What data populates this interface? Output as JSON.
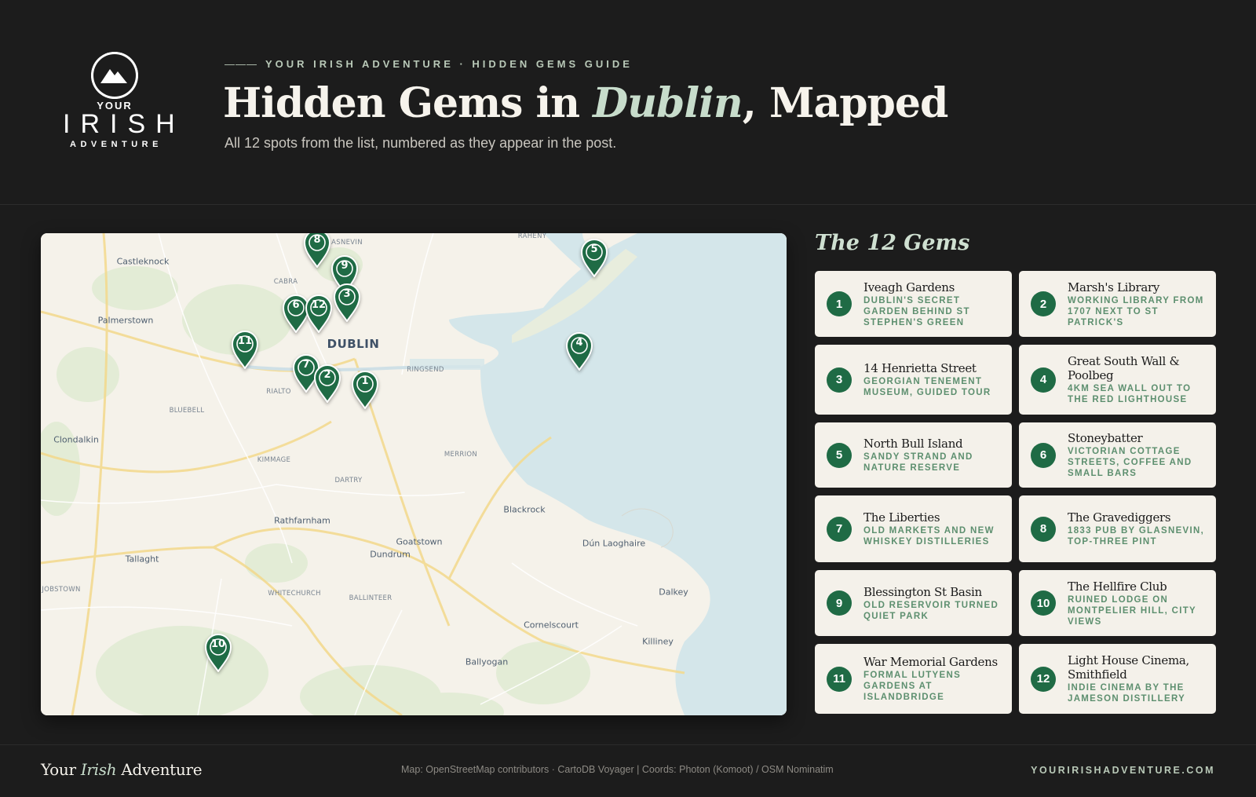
{
  "brand": {
    "logo_your": "YOUR",
    "logo_irish": "IRISH",
    "logo_adventure": "ADVENTURE"
  },
  "header": {
    "kicker_dash": "———",
    "kicker": "YOUR IRISH ADVENTURE · HIDDEN GEMS GUIDE",
    "title_before": "Hidden Gems in ",
    "title_em": "Dublin",
    "title_after": ", Mapped",
    "subtitle": "All 12 spots from the list, numbered as they appear in the post."
  },
  "map": {
    "places": [
      {
        "name": "Castleknock",
        "cls": "major"
      },
      {
        "name": "ASNEVIN",
        "cls": "small"
      },
      {
        "name": "RAHENY",
        "cls": "small"
      },
      {
        "name": "CABRA",
        "cls": "small"
      },
      {
        "name": "Palmerstown",
        "cls": "major"
      },
      {
        "name": "DUBLIN",
        "cls": "city"
      },
      {
        "name": "RINGSEND",
        "cls": "small"
      },
      {
        "name": "RIALTO",
        "cls": "small"
      },
      {
        "name": "BLUEBELL",
        "cls": "small"
      },
      {
        "name": "Clondalkin",
        "cls": "major"
      },
      {
        "name": "MERRION",
        "cls": "small"
      },
      {
        "name": "KIMMAGE",
        "cls": "small"
      },
      {
        "name": "DARTRY",
        "cls": "small"
      },
      {
        "name": "Blackrock",
        "cls": "major"
      },
      {
        "name": "Rathfarnham",
        "cls": "major"
      },
      {
        "name": "Goatstown",
        "cls": "major"
      },
      {
        "name": "Dún Laoghaire",
        "cls": "major"
      },
      {
        "name": "Dundrum",
        "cls": "major"
      },
      {
        "name": "Tallaght",
        "cls": "major"
      },
      {
        "name": "JOBSTOWN",
        "cls": "small"
      },
      {
        "name": "WHITECHURCH",
        "cls": "small"
      },
      {
        "name": "BALLINTEER",
        "cls": "small"
      },
      {
        "name": "Dalkey",
        "cls": "major"
      },
      {
        "name": "Cornelscourt",
        "cls": "major"
      },
      {
        "name": "Killiney",
        "cls": "major"
      },
      {
        "name": "Ballyogan",
        "cls": "major"
      }
    ],
    "pins": [
      "8",
      "9",
      "3",
      "6",
      "12",
      "11",
      "7",
      "2",
      "1",
      "5",
      "4",
      "10"
    ]
  },
  "sidebar": {
    "title": "The 12 Gems",
    "gems": [
      {
        "num": "1",
        "name": "Iveagh Gardens",
        "desc": "Dublin's secret garden behind St Stephen's Green"
      },
      {
        "num": "2",
        "name": "Marsh's Library",
        "desc": "Working library from 1707 next to St Patrick's"
      },
      {
        "num": "3",
        "name": "14 Henrietta Street",
        "desc": "Georgian tenement museum, guided tour"
      },
      {
        "num": "4",
        "name": "Great South Wall & Poolbeg",
        "desc": "4km sea wall out to the red lighthouse"
      },
      {
        "num": "5",
        "name": "North Bull Island",
        "desc": "Sandy strand and nature reserve"
      },
      {
        "num": "6",
        "name": "Stoneybatter",
        "desc": "Victorian cottage streets, coffee and small bars"
      },
      {
        "num": "7",
        "name": "The Liberties",
        "desc": "Old markets and new whiskey distilleries"
      },
      {
        "num": "8",
        "name": "The Gravediggers",
        "desc": "1833 pub by Glasnevin, top-three pint"
      },
      {
        "num": "9",
        "name": "Blessington St Basin",
        "desc": "Old reservoir turned quiet park"
      },
      {
        "num": "10",
        "name": "The Hellfire Club",
        "desc": "Ruined lodge on Montpelier Hill, city views"
      },
      {
        "num": "11",
        "name": "War Memorial Gardens",
        "desc": "Formal Lutyens gardens at Islandbridge"
      },
      {
        "num": "12",
        "name": "Light House Cinema, Smithfield",
        "desc": "Indie cinema by the Jameson Distillery"
      }
    ]
  },
  "footer": {
    "brand_before": "Your ",
    "brand_em": "Irish",
    "brand_after": " Adventure",
    "credit": "Map: OpenStreetMap contributors · CartoDB Voyager | Coords: Photon (Komoot) / OSM Nominatim",
    "url": "YOURIRISHADVENTURE.COM"
  },
  "colors": {
    "background": "#1c1c1c",
    "accent_green": "#1f6b45",
    "card_bg": "#f4f1ea",
    "sea": "#d4e6ea"
  }
}
